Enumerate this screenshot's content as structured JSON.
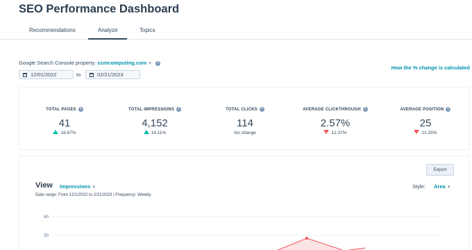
{
  "header": {
    "title": "SEO Performance Dashboard"
  },
  "tabs": [
    {
      "label": "Recommendations"
    },
    {
      "label": "Analyze",
      "active": true
    },
    {
      "label": "Topics"
    }
  ],
  "property": {
    "label": "Google Search Console property:",
    "value": "ccmcomputing.com"
  },
  "date_range": {
    "start": "12/01/2022",
    "to_label": "to",
    "end": "02/21/2023"
  },
  "help_link": "How the % change is calculated",
  "kpis": [
    {
      "label": "TOTAL PAGES",
      "value": "41",
      "change": "16.67%",
      "direction": "up"
    },
    {
      "label": "TOTAL IMPRESSIONS",
      "value": "4,152",
      "change": "14.11%",
      "direction": "up"
    },
    {
      "label": "TOTAL CLICKS",
      "value": "114",
      "change": "No change",
      "direction": "none"
    },
    {
      "label": "AVERAGE CLICKTHROUGH",
      "value": "2.57%",
      "change": "12.37%",
      "direction": "down"
    },
    {
      "label": "AVERAGE POSITION",
      "value": "25",
      "change": "21.25%",
      "direction": "down"
    }
  ],
  "chart_panel": {
    "export_label": "Export",
    "view_label": "View",
    "view_value": "Impressions",
    "meta": "Date range: From 12/1/2022 to 2/21/2023  |  Frequency: Weekly",
    "style_label": "Style:",
    "style_value": "Area"
  },
  "chart_data": {
    "type": "area",
    "y_ticks": [
      "60",
      "50"
    ],
    "series_color": "#f2545b",
    "fill_color": "#fce3e4"
  },
  "colors": {
    "accent": "#0091ae",
    "up": "#00bda5",
    "down": "#f2545b",
    "text": "#33475b"
  }
}
